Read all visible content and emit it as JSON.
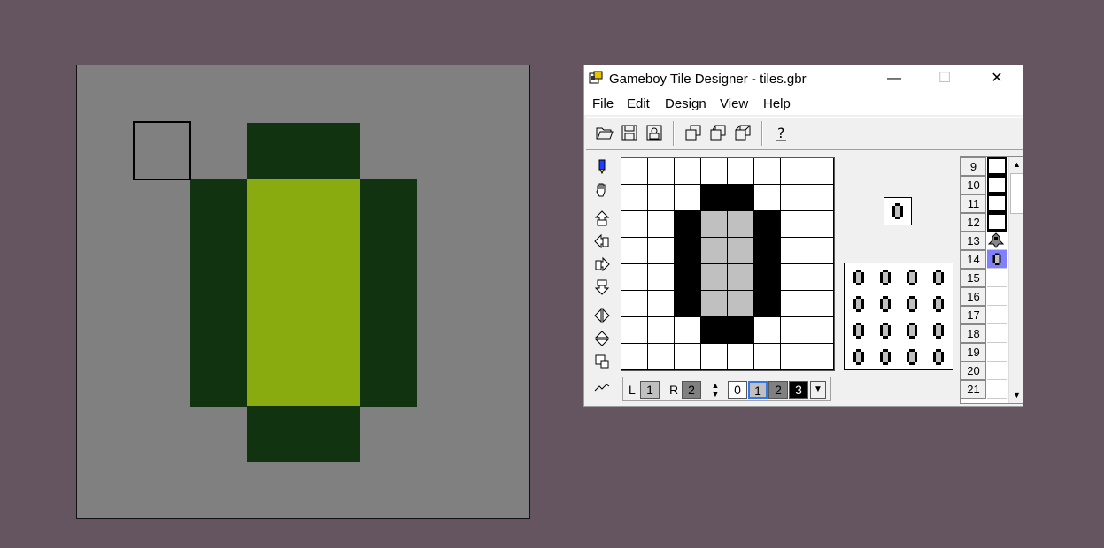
{
  "preview": {
    "colors": {
      "background": "#808080",
      "dark": "#12330f",
      "light": "#8aab10"
    }
  },
  "window": {
    "title": "Gameboy Tile Designer - tiles.gbr",
    "controls": {
      "minimize": "—",
      "maximize": "☐",
      "close": "✕"
    },
    "menu": [
      "File",
      "Edit",
      "Design",
      "View",
      "Help"
    ],
    "toolbar": {
      "buttons": [
        "open-icon",
        "save-icon",
        "export-icon",
        "copy-icon",
        "paste-icon",
        "duplicate-icon",
        "help-icon"
      ]
    },
    "tools": [
      "pen-icon",
      "hand-icon",
      "shift-up-icon",
      "shift-left-icon",
      "shift-right-icon",
      "shift-down-icon",
      "flip-horizontal-icon",
      "flip-vertical-icon",
      "rotate-icon",
      "hint-icon"
    ],
    "colorbar": {
      "left_label": "L",
      "left_value": "1",
      "right_label": "R",
      "right_value": "2",
      "palette": [
        "0",
        "1",
        "2",
        "3"
      ]
    },
    "tile_pixels": [
      [
        0,
        0,
        0,
        0,
        0,
        0,
        0,
        0
      ],
      [
        0,
        0,
        0,
        3,
        3,
        0,
        0,
        0
      ],
      [
        0,
        0,
        3,
        2,
        2,
        3,
        0,
        0
      ],
      [
        0,
        0,
        3,
        2,
        2,
        3,
        0,
        0
      ],
      [
        0,
        0,
        3,
        2,
        2,
        3,
        0,
        0
      ],
      [
        0,
        0,
        3,
        2,
        2,
        3,
        0,
        0
      ],
      [
        0,
        0,
        0,
        3,
        3,
        0,
        0,
        0
      ],
      [
        0,
        0,
        0,
        0,
        0,
        0,
        0,
        0
      ]
    ],
    "shade_colors": [
      "#ffffff",
      "#c0c0c0",
      "#c0c0c0",
      "#000000"
    ],
    "tile_list": [
      {
        "num": "9",
        "kind": "frame"
      },
      {
        "num": "10",
        "kind": "frame"
      },
      {
        "num": "11",
        "kind": "frame"
      },
      {
        "num": "12",
        "kind": "frame"
      },
      {
        "num": "13",
        "kind": "sprite"
      },
      {
        "num": "14",
        "kind": "zero",
        "selected": true
      },
      {
        "num": "15",
        "kind": "empty"
      },
      {
        "num": "16",
        "kind": "empty"
      },
      {
        "num": "17",
        "kind": "empty"
      },
      {
        "num": "18",
        "kind": "empty"
      },
      {
        "num": "19",
        "kind": "empty"
      },
      {
        "num": "20",
        "kind": "empty"
      },
      {
        "num": "21",
        "kind": "empty"
      }
    ],
    "scroll": {
      "up": "▲",
      "down": "▼"
    }
  }
}
